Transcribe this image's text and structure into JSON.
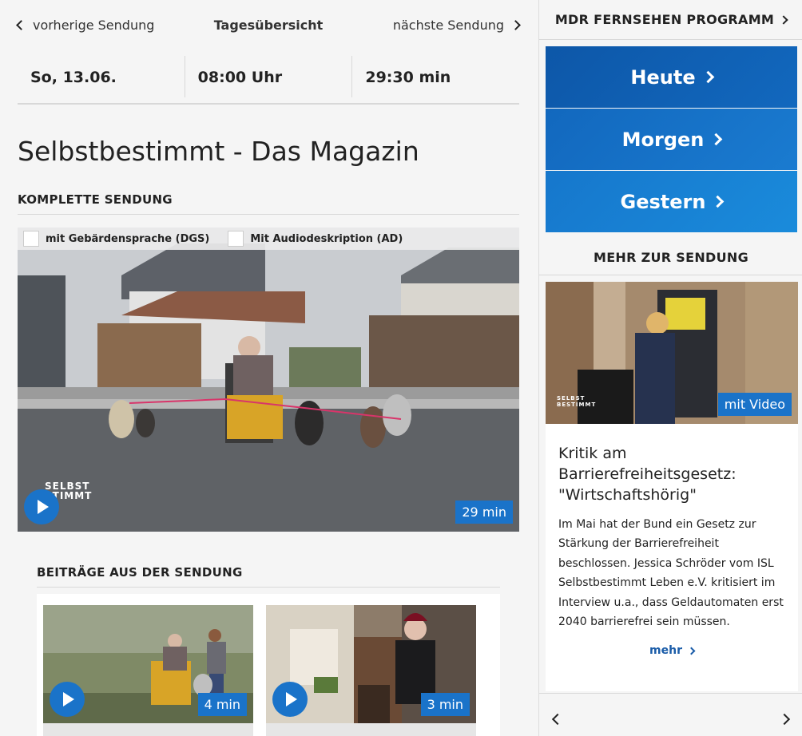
{
  "nav": {
    "prev_label": "vorherige Sendung",
    "center_label": "Tagesübersicht",
    "next_label": "nächste Sendung"
  },
  "info": {
    "date": "So, 13.06.",
    "time": "08:00 Uhr",
    "duration": "29:30 min"
  },
  "title": "Selbstbestimmt - Das Magazin",
  "komplette": {
    "heading": "KOMPLETTE SENDUNG",
    "option_dgs": "mit Gebärdensprache (DGS)",
    "option_ad": "Mit Audiodeskription (AD)",
    "duration_badge": "29 min",
    "watermark_line1": "SELBST",
    "watermark_line2": "STIMMT"
  },
  "beitraege": {
    "heading": "BEITRÄGE AUS DER SENDUNG",
    "items": [
      {
        "duration": "4 min"
      },
      {
        "duration": "3 min"
      }
    ]
  },
  "sidebar": {
    "program_label": "MDR FERNSEHEN PROGRAMM",
    "days": [
      "Heute",
      "Morgen",
      "Gestern"
    ],
    "mehr_heading": "MEHR ZUR SENDUNG",
    "teaser": {
      "badge": "mit Video",
      "title": "Kritik am Barrierefreiheitsgesetz: \"Wirtschaftshörig\"",
      "text": "Im Mai hat der Bund ein Gesetz zur Stärkung der Barrierefreiheit beschlossen. Jessica Schröder vom ISL Selbstbestimmt Leben e.V. kritisiert im Interview u.a., dass Geldautomaten erst 2040 barrierefrei sein müssen.",
      "more_label": "mehr",
      "watermark_line1": "SELBST",
      "watermark_line2": "BESTIMMT"
    }
  },
  "colors": {
    "accent_blue": "#1a73c9",
    "link_blue": "#1a5ca8"
  }
}
